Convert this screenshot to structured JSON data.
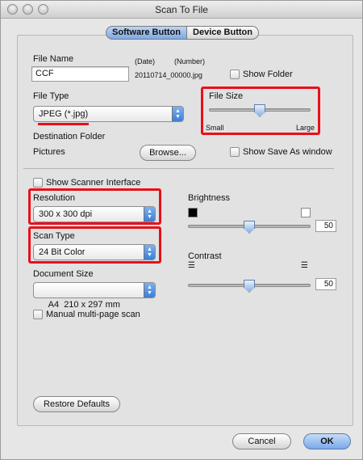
{
  "window": {
    "title": "Scan To File"
  },
  "tabs": {
    "software": "Software Button",
    "device": "Device Button"
  },
  "file_name": {
    "label": "File Name",
    "value": "CCF",
    "date_label": "(Date)",
    "number_label": "(Number)",
    "preview": "20110714_00000.jpg",
    "show_folder": "Show Folder"
  },
  "file_type": {
    "label": "File Type",
    "value": "JPEG (*.jpg)"
  },
  "file_size": {
    "label": "File Size",
    "min_label": "Small",
    "max_label": "Large",
    "level": 0.5
  },
  "destination": {
    "label": "Destination Folder",
    "value": "Pictures",
    "browse": "Browse...",
    "show_save_as": "Show Save As window"
  },
  "scanner_interface": "Show Scanner Interface",
  "resolution": {
    "label": "Resolution",
    "value": "300 x 300 dpi"
  },
  "scan_type": {
    "label": "Scan Type",
    "value": "24 Bit Color"
  },
  "document_size": {
    "label": "Document Size",
    "value": "A4  210 x 297 mm"
  },
  "manual_scan": "Manual multi-page scan",
  "brightness": {
    "label": "Brightness",
    "value": "50"
  },
  "contrast": {
    "label": "Contrast",
    "value": "50"
  },
  "buttons": {
    "restore": "Restore Defaults",
    "cancel": "Cancel",
    "ok": "OK"
  },
  "colors": {
    "highlight": "#e8101a",
    "accent": "#3b7fd6"
  }
}
